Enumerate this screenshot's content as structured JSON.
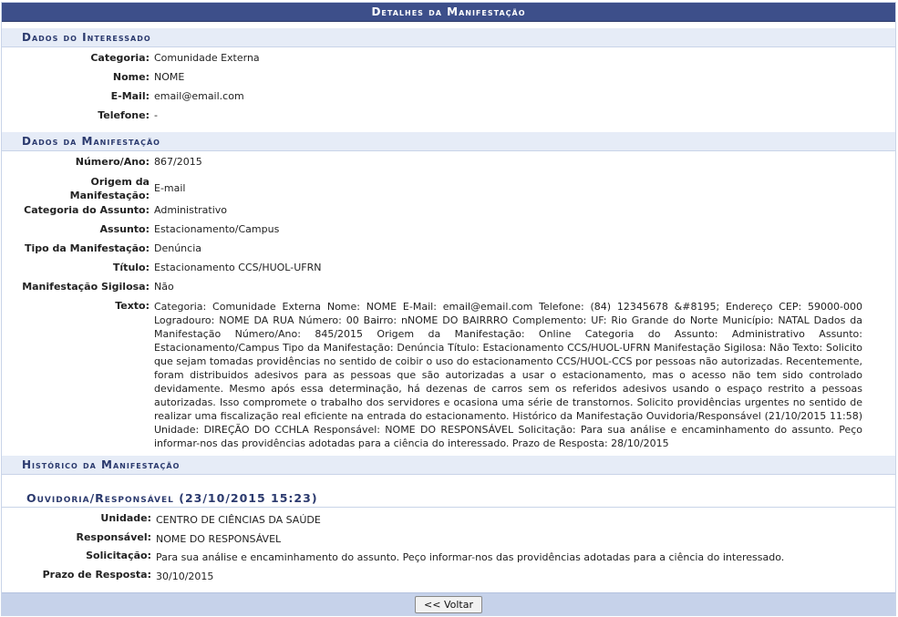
{
  "caption": "Detalhes da Manifestação",
  "interessado": {
    "title": "Dados do Interessado",
    "rows": [
      {
        "label": "Categoria:",
        "value": "Comunidade Externa"
      },
      {
        "label": "Nome:",
        "value": "NOME"
      },
      {
        "label": "E-Mail:",
        "value": "email@email.com"
      },
      {
        "label": "Telefone:",
        "value": "-"
      }
    ]
  },
  "manifestacao": {
    "title": "Dados da Manifestação",
    "numero_label": "Número/Ano:",
    "numero": "867/2015",
    "origem_label_1": "Origem da",
    "origem_label_2": "Manifestação:",
    "origem": "E-mail",
    "categoria_label": "Categoria do Assunto:",
    "categoria": "Administrativo",
    "assunto_label": "Assunto:",
    "assunto": "Estacionamento/Campus",
    "tipo_label": "Tipo da Manifestação:",
    "tipo": "Denúncia",
    "titulo_label": "Título:",
    "titulo": "Estacionamento CCS/HUOL-UFRN",
    "sigilosa_label": "Manifestação Sigilosa:",
    "sigilosa": "Não",
    "texto_label": "Texto:",
    "texto": "Categoria: Comunidade Externa Nome: NOME E-Mail: email@email.com Telefone: (84) 12345678 &#8195; Endereço CEP: 59000-000 Logradouro: NOME DA RUA Número: 00 Bairro: nNOME DO BAIRRRO Complemento: UF: Rio Grande do Norte Município: NATAL Dados da Manifestação Número/Ano: 845/2015 Origem da Manifestação: Online Categoria do Assunto: Administrativo Assunto: Estacionamento/Campus Tipo da Manifestação: Denúncia Título: Estacionamento CCS/HUOL-UFRN Manifestação Sigilosa: Não Texto: Solicito que sejam tomadas providências no sentido de coibir o uso do estacionamento CCS/HUOL-CCS por pessoas não autorizadas. Recentemente, foram distribuidos adesivos para as pessoas que são autorizadas a usar o estacionamento, mas o acesso não tem sido controlado devidamente. Mesmo após essa determinação, há dezenas de carros sem os referidos adesivos usando o espaço restrito a pessoas autorizadas. Isso compromete o trabalho dos servidores e ocasiona uma série de transtornos. Solicito providências urgentes no sentido de realizar uma fiscalização real eficiente na entrada do estacionamento. Histórico da Manifestação Ouvidoria/Responsável (21/10/2015 11:58) Unidade: DIREÇÃO DO CCHLA Responsável: NOME DO RESPONSÁVEL Solicitação: Para sua análise e encaminhamento do assunto. Peço informar-nos das providências adotadas para a ciência do interessado. Prazo de Resposta: 28/10/2015"
  },
  "historico": {
    "title": "Histórico da Manifestação",
    "entry_title": "Ouvidoria/Responsável (23/10/2015 15:23)",
    "rows": [
      {
        "label": "Unidade:",
        "value": "CENTRO DE CIÊNCIAS DA SAÚDE"
      },
      {
        "label": "Responsável:",
        "value": "NOME DO RESPONSÁVEL"
      },
      {
        "label": "Solicitação:",
        "value": "Para sua análise e encaminhamento do assunto. Peço informar-nos das providências adotadas para a ciência do interessado."
      },
      {
        "label": "Prazo de Resposta:",
        "value": "30/10/2015"
      }
    ]
  },
  "footer": {
    "back_label": "<< Voltar"
  }
}
